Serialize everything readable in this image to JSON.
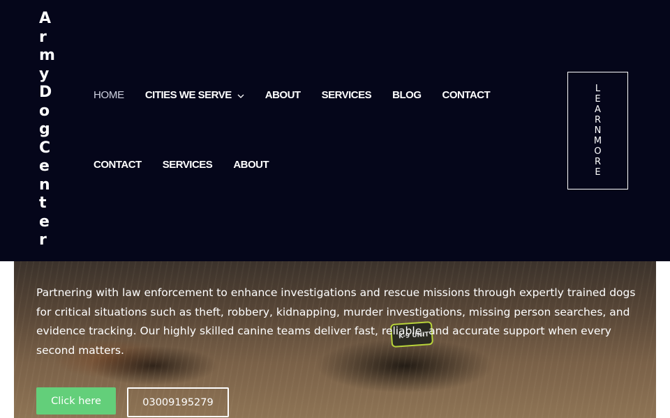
{
  "logo": {
    "letters": [
      "A",
      "r",
      "m",
      "y",
      "D",
      "o",
      "g",
      "C",
      "e",
      "n",
      "t",
      "e",
      "r"
    ]
  },
  "nav": {
    "row1": [
      {
        "label": "HOME"
      },
      {
        "label": "CITIES WE SERVE",
        "icon": "chevron-down-icon"
      },
      {
        "label": "ABOUT"
      },
      {
        "label": "SERVICES"
      },
      {
        "label": "BLOG"
      },
      {
        "label": "CONTACT"
      }
    ],
    "row2": [
      {
        "label": "CONTACT"
      },
      {
        "label": "SERVICES"
      },
      {
        "label": "ABOUT"
      }
    ]
  },
  "learn_more": {
    "letters": [
      "L",
      "E",
      "A",
      "R",
      "N",
      "M",
      "O",
      "R",
      "E"
    ]
  },
  "hero": {
    "description": "Partnering with law enforcement to enhance investigations and rescue missions through expertly trained dogs for critical situations such as theft, robbery, kidnapping, murder investigations, missing person searches, and evidence tracking. Our highly skilled canine teams deliver fast, reliable, and accurate support when every second matters.",
    "vest_label": "K-9 UNIT",
    "primary_button": "Click here",
    "phone_button": "03009195279"
  },
  "colors": {
    "header_bg": "#05061a",
    "accent_green": "#63cf7a",
    "text": "#ffffff"
  }
}
